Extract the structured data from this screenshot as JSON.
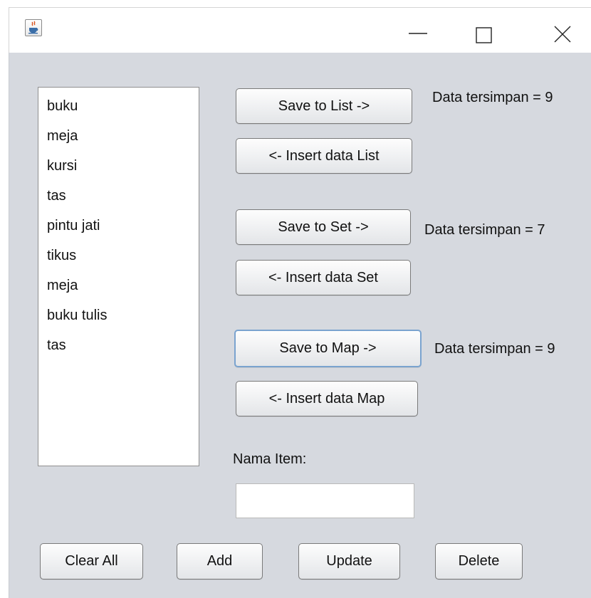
{
  "window": {
    "icon": "java-coffee-icon",
    "controls": [
      "minimize-icon",
      "maximize-icon",
      "close-icon"
    ]
  },
  "list": {
    "items": [
      "buku",
      "meja",
      "kursi",
      "tas",
      "pintu jati",
      "tikus",
      "meja",
      "buku tulis",
      "tas"
    ]
  },
  "buttons": {
    "save_list": "Save to List ->",
    "insert_list": "<- Insert data List",
    "save_set": "Save to Set ->",
    "insert_set": "<- Insert data Set",
    "save_map": "Save to Map ->",
    "insert_map": "<- Insert data Map",
    "clear_all": "Clear All",
    "add": "Add",
    "update": "Update",
    "delete": "Delete"
  },
  "status": {
    "list": "Data tersimpan = 9",
    "set": "Data tersimpan = 7",
    "map": "Data tersimpan = 9"
  },
  "form": {
    "nama_item_label": "Nama Item:",
    "nama_item_value": ""
  },
  "colors": {
    "panel_background": "#d6d9df",
    "focus_border": "#7aa3cf"
  }
}
